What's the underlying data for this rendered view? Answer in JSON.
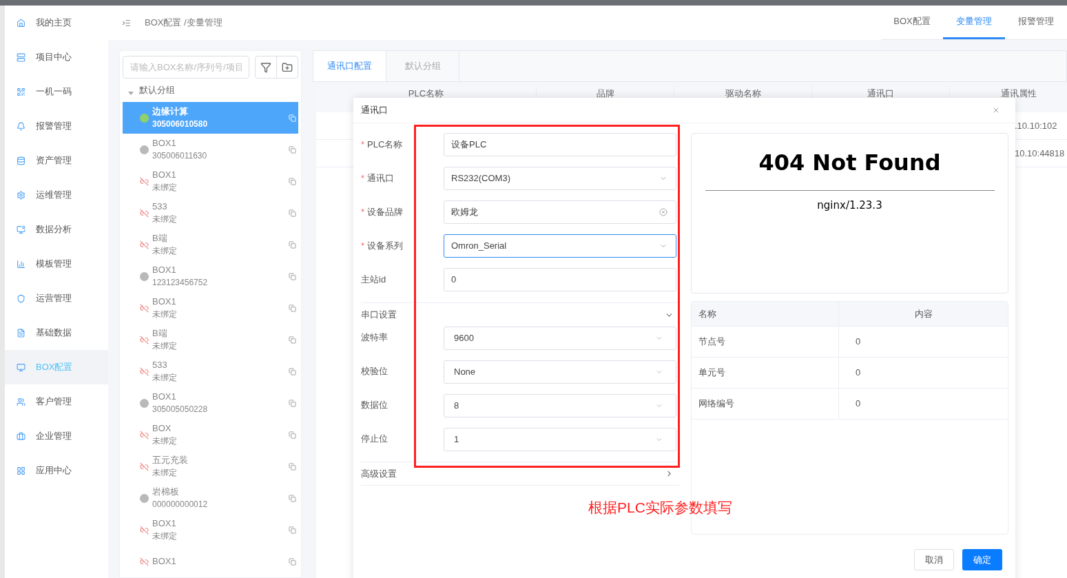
{
  "top_bar": {
    "breadcrumb": "BOX配置 /变量管理",
    "tabs": [
      {
        "label": "BOX配置",
        "selected": false
      },
      {
        "label": "变量管理",
        "selected": true
      },
      {
        "label": "报警管理",
        "selected": false
      }
    ]
  },
  "sidebar": {
    "items": [
      {
        "label": "我的主页",
        "selected": false
      },
      {
        "label": "项目中心",
        "selected": false
      },
      {
        "label": "一机一码",
        "selected": false
      },
      {
        "label": "报警管理",
        "selected": false
      },
      {
        "label": "资产管理",
        "selected": false
      },
      {
        "label": "运维管理",
        "selected": false
      },
      {
        "label": "数据分析",
        "selected": false
      },
      {
        "label": "模板管理",
        "selected": false
      },
      {
        "label": "运营管理",
        "selected": false
      },
      {
        "label": "基础数据",
        "selected": false
      },
      {
        "label": "BOX配置",
        "selected": true
      },
      {
        "label": "客户管理",
        "selected": false
      },
      {
        "label": "企业管理",
        "selected": false
      },
      {
        "label": "应用中心",
        "selected": false
      }
    ]
  },
  "device_panel": {
    "search": {
      "placeholder": "请输入BOX名称/序列号/项目"
    },
    "group": "默认分组",
    "devices": [
      {
        "name": "边缘计算",
        "sub": "305006010580",
        "kind": "online",
        "selected": true
      },
      {
        "name": "BOX1",
        "sub": "305006011630",
        "kind": "offline",
        "selected": false
      },
      {
        "name": "BOX1",
        "sub": "未绑定",
        "kind": "unbound",
        "selected": false
      },
      {
        "name": "533",
        "sub": "未绑定",
        "kind": "unbound",
        "selected": false
      },
      {
        "name": "B端",
        "sub": "未绑定",
        "kind": "unbound",
        "selected": false
      },
      {
        "name": "BOX1",
        "sub": "123123456752",
        "kind": "offline",
        "selected": false
      },
      {
        "name": "BOX1",
        "sub": "未绑定",
        "kind": "unbound",
        "selected": false
      },
      {
        "name": "B端",
        "sub": "未绑定",
        "kind": "unbound",
        "selected": false
      },
      {
        "name": "533",
        "sub": "未绑定",
        "kind": "unbound",
        "selected": false
      },
      {
        "name": "BOX1",
        "sub": "305005050228",
        "kind": "offline",
        "selected": false
      },
      {
        "name": "BOX",
        "sub": "未绑定",
        "kind": "unbound",
        "selected": false
      },
      {
        "name": "五元充装",
        "sub": "未绑定",
        "kind": "unbound",
        "selected": false
      },
      {
        "name": "岩棉板",
        "sub": "000000000012",
        "kind": "offline",
        "selected": false
      },
      {
        "name": "BOX1",
        "sub": "未绑定",
        "kind": "unbound",
        "selected": false
      },
      {
        "name": "BOX1",
        "kind": "unbound",
        "selected": false
      }
    ]
  },
  "content_tabs": [
    {
      "label": "通讯口配置",
      "selected": true
    },
    {
      "label": "默认分组",
      "selected": false
    }
  ],
  "table": {
    "columns": [
      "PLC名称",
      "品牌",
      "驱动名称",
      "通讯口",
      "通讯属性"
    ],
    "rows": [
      {
        "column_5": ".10.10:102"
      },
      {
        "column_5": "10.10:44818"
      }
    ]
  },
  "dialog": {
    "title": "通讯口",
    "fields": [
      {
        "label": "PLC名称",
        "required_mark": "*",
        "value": "设备PLC",
        "kind": "input",
        "focused": false
      },
      {
        "label": "通讯口",
        "required_mark": "*",
        "value": "RS232(COM3)",
        "kind": "select",
        "focused": false
      },
      {
        "label": "设备品牌",
        "required_mark": "*",
        "value": "欧姆龙",
        "kind": "clearable",
        "focused": false
      },
      {
        "label": "设备系列",
        "required_mark": "*",
        "value": "Omron_Serial",
        "kind": "select",
        "focused": true
      },
      {
        "label": "主站id",
        "value": "0",
        "kind": "input",
        "focused": false
      }
    ],
    "serial_section": {
      "title": "串口设置",
      "expanded": true,
      "fields": [
        {
          "label": "波特率",
          "value": "9600"
        },
        {
          "label": "校验位",
          "value": "None"
        },
        {
          "label": "数据位",
          "value": "8"
        },
        {
          "label": "停止位",
          "value": "1"
        }
      ]
    },
    "advanced_section": {
      "title": "高级设置",
      "expanded": false
    },
    "error_page": {
      "heading": "404 Not Found",
      "server": "nginx/1.23.3"
    },
    "params_table": {
      "columns": [
        "名称",
        "内容"
      ],
      "rows": [
        [
          "节点号",
          "0"
        ],
        [
          "单元号",
          "0"
        ],
        [
          "网络编号",
          "0"
        ]
      ]
    },
    "buttons": {
      "cancel": "取消",
      "confirm": "确定"
    }
  },
  "annotation": {
    "note": "根据PLC实际参数填写"
  }
}
